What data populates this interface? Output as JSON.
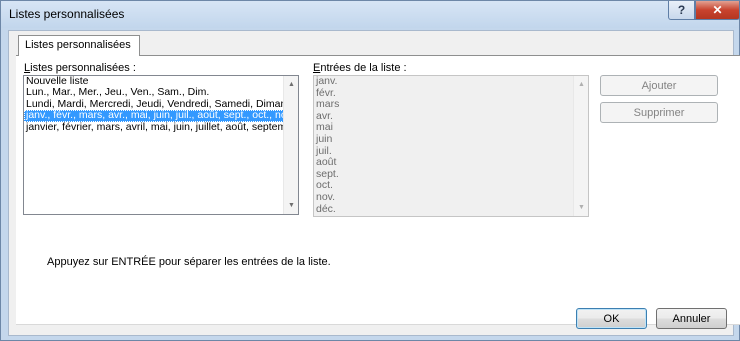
{
  "window": {
    "title": "Listes personnalisées"
  },
  "titlebar_buttons": {
    "help": "?",
    "close": "✕"
  },
  "tab": {
    "label": "Listes personnalisées"
  },
  "custom_lists": {
    "label": "Listes personnalisées :",
    "items": [
      "Nouvelle liste",
      "Lun., Mar., Mer., Jeu., Ven., Sam., Dim.",
      "Lundi, Mardi, Mercredi, Jeudi, Vendredi, Samedi, Dimanche",
      "janv., févr., mars, avr., mai, juin, juil., août, sept., oct., nov., déc.",
      "janvier, février, mars, avril, mai, juin, juillet, août, septembre, octobre, novembre, décembre"
    ],
    "selected_index": 3
  },
  "entries": {
    "label": "Entrées de la liste :",
    "items": [
      "janv.",
      "févr.",
      "mars",
      "avr.",
      "mai",
      "juin",
      "juil.",
      "août",
      "sept.",
      "oct.",
      "nov.",
      "déc."
    ]
  },
  "buttons": {
    "add": "Ajouter",
    "delete": "Supprimer",
    "ok": "OK",
    "cancel": "Annuler"
  },
  "hint": "Appuyez sur ENTRÉE pour séparer les entrées de la liste."
}
